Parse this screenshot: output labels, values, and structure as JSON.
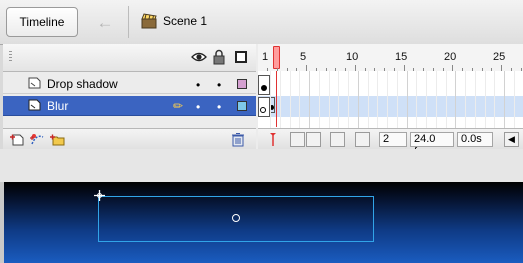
{
  "toolbar": {
    "tab_label": "Timeline",
    "back_icon": "left-arrow",
    "scene_label": "Scene 1",
    "scene_icon": "clapperboard-icon"
  },
  "timeline": {
    "header_icons": [
      "eye-icon",
      "lock-icon",
      "outline-icon"
    ],
    "ruler_labels": [
      "1",
      "5",
      "10",
      "15",
      "20",
      "25"
    ],
    "current_frame": 2,
    "layers": [
      {
        "name": "Drop shadow",
        "selected": false,
        "outline_color": "#d4a0d0",
        "icon": "layer-icon"
      },
      {
        "name": "Blur",
        "selected": true,
        "outline_color": "#7ec8e8",
        "icon": "layer-icon"
      }
    ],
    "status": {
      "frame": "2",
      "fps": "24.0 fps",
      "time": "0.0s"
    },
    "tool_icons": [
      "insert-layer-icon",
      "add-motion-guide-icon",
      "insert-layer-folder-icon",
      "trash-icon"
    ]
  },
  "colors": {
    "selected_row": "#3b64c1",
    "playhead": "#e03232",
    "selection_outline": "#31a4e8"
  }
}
